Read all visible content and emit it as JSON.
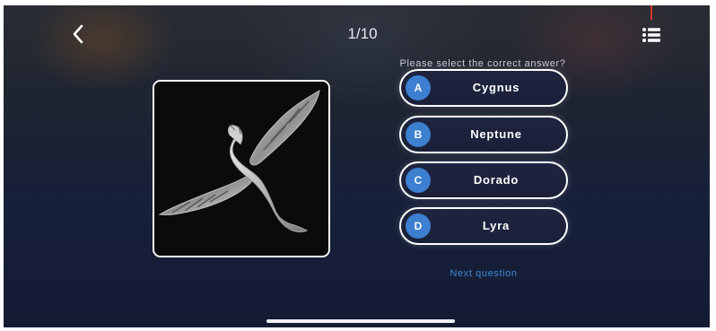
{
  "header": {
    "back_icon": "chevron-left-icon",
    "progress": "1/10",
    "menu_icon": "list-icon"
  },
  "quiz": {
    "prompt": "Please select the correct answer?",
    "image_subject": "swan-constellation-art",
    "options": [
      {
        "letter": "A",
        "label": "Cygnus"
      },
      {
        "letter": "B",
        "label": "Neptune"
      },
      {
        "letter": "C",
        "label": "Dorado"
      },
      {
        "letter": "D",
        "label": "Lyra"
      }
    ],
    "next_label": "Next question"
  },
  "colors": {
    "badge": "#3d7fd0",
    "link": "#3b89d6",
    "marker": "#d9342b"
  }
}
